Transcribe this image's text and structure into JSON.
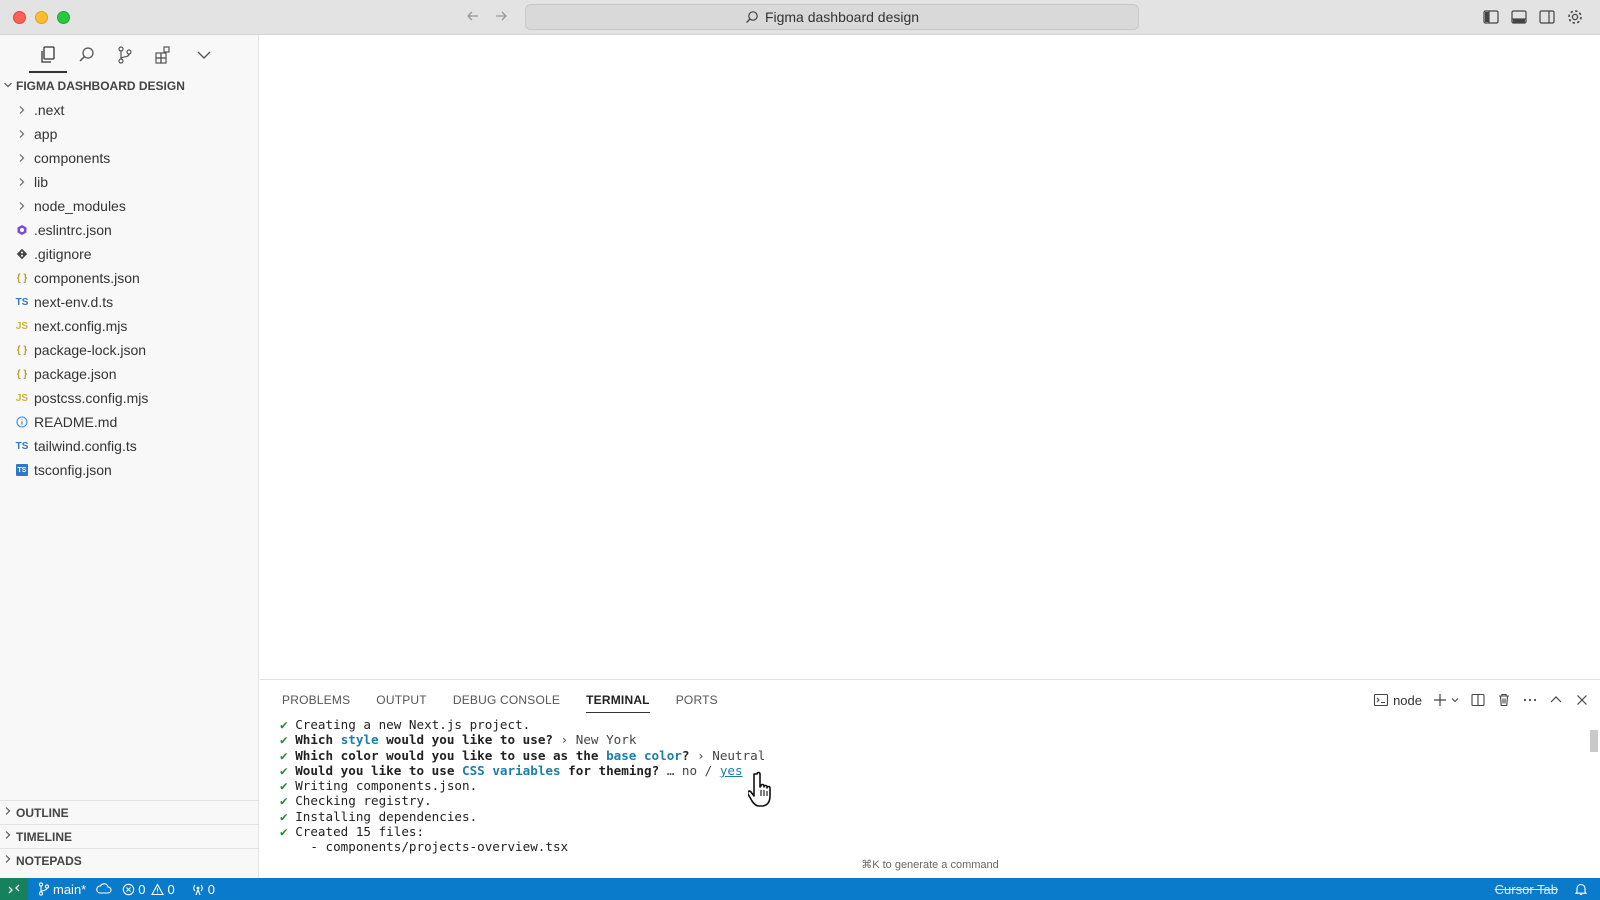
{
  "titlebar": {
    "search_text": "Figma dashboard design"
  },
  "sidebar": {
    "explorer_title": "FIGMA DASHBOARD DESIGN",
    "items": [
      {
        "label": ".next",
        "icon": "chevron-right-icon"
      },
      {
        "label": "app",
        "icon": "chevron-right-icon"
      },
      {
        "label": "components",
        "icon": "chevron-right-icon"
      },
      {
        "label": "lib",
        "icon": "chevron-right-icon"
      },
      {
        "label": "node_modules",
        "icon": "chevron-right-icon"
      },
      {
        "label": ".eslintrc.json",
        "icon": "eslint-icon"
      },
      {
        "label": ".gitignore",
        "icon": "git-icon"
      },
      {
        "label": "components.json",
        "icon": "json-icon"
      },
      {
        "label": "next-env.d.ts",
        "icon": "typescript-icon"
      },
      {
        "label": "next.config.mjs",
        "icon": "javascript-icon"
      },
      {
        "label": "package-lock.json",
        "icon": "json-icon"
      },
      {
        "label": "package.json",
        "icon": "json-icon"
      },
      {
        "label": "postcss.config.mjs",
        "icon": "javascript-icon"
      },
      {
        "label": "README.md",
        "icon": "info-icon"
      },
      {
        "label": "tailwind.config.ts",
        "icon": "typescript-icon"
      },
      {
        "label": "tsconfig.json",
        "icon": "tsconfig-icon"
      }
    ],
    "icon_text": {
      "ts": "TS",
      "js": "JS",
      "json": "{ }"
    },
    "sections": {
      "outline": "OUTLINE",
      "timeline": "TIMELINE",
      "notepads": "NOTEPADS"
    }
  },
  "panel": {
    "tabs": {
      "problems": "PROBLEMS",
      "output": "OUTPUT",
      "debug_console": "DEBUG CONSOLE",
      "terminal": "TERMINAL",
      "ports": "PORTS"
    },
    "terminal_name": "node",
    "terminal": {
      "check": "✔",
      "line1": "Creating a new Next.js project.",
      "line2_a": "Which ",
      "line2_b": "style",
      "line2_c": " would you like to use?",
      "line2_d": " › New York",
      "line3_a": "Which color would you like to use as the ",
      "line3_b": "base color",
      "line3_c": "?",
      "line3_d": " › Neutral",
      "line4_a": "Would you like to use ",
      "line4_b": "CSS variables",
      "line4_c": " for theming?",
      "line4_d": " … no / ",
      "line4_e": "yes",
      "line5": "Writing components.json.",
      "line6": "Checking registry.",
      "line7": "Installing dependencies.",
      "line8": "Created 15 files:",
      "line9": "  - components/projects-overview.tsx"
    },
    "hint": "⌘K to generate a command"
  },
  "statusbar": {
    "branch": "main*",
    "errors": "0",
    "warnings": "0",
    "ports": "0",
    "cursor_tab": "Cursor Tab"
  },
  "colors": {
    "statusbar": "#0a7aca",
    "remote": "#16825d",
    "check": "#1f8a3a",
    "highlight": "#1a7fa8"
  }
}
